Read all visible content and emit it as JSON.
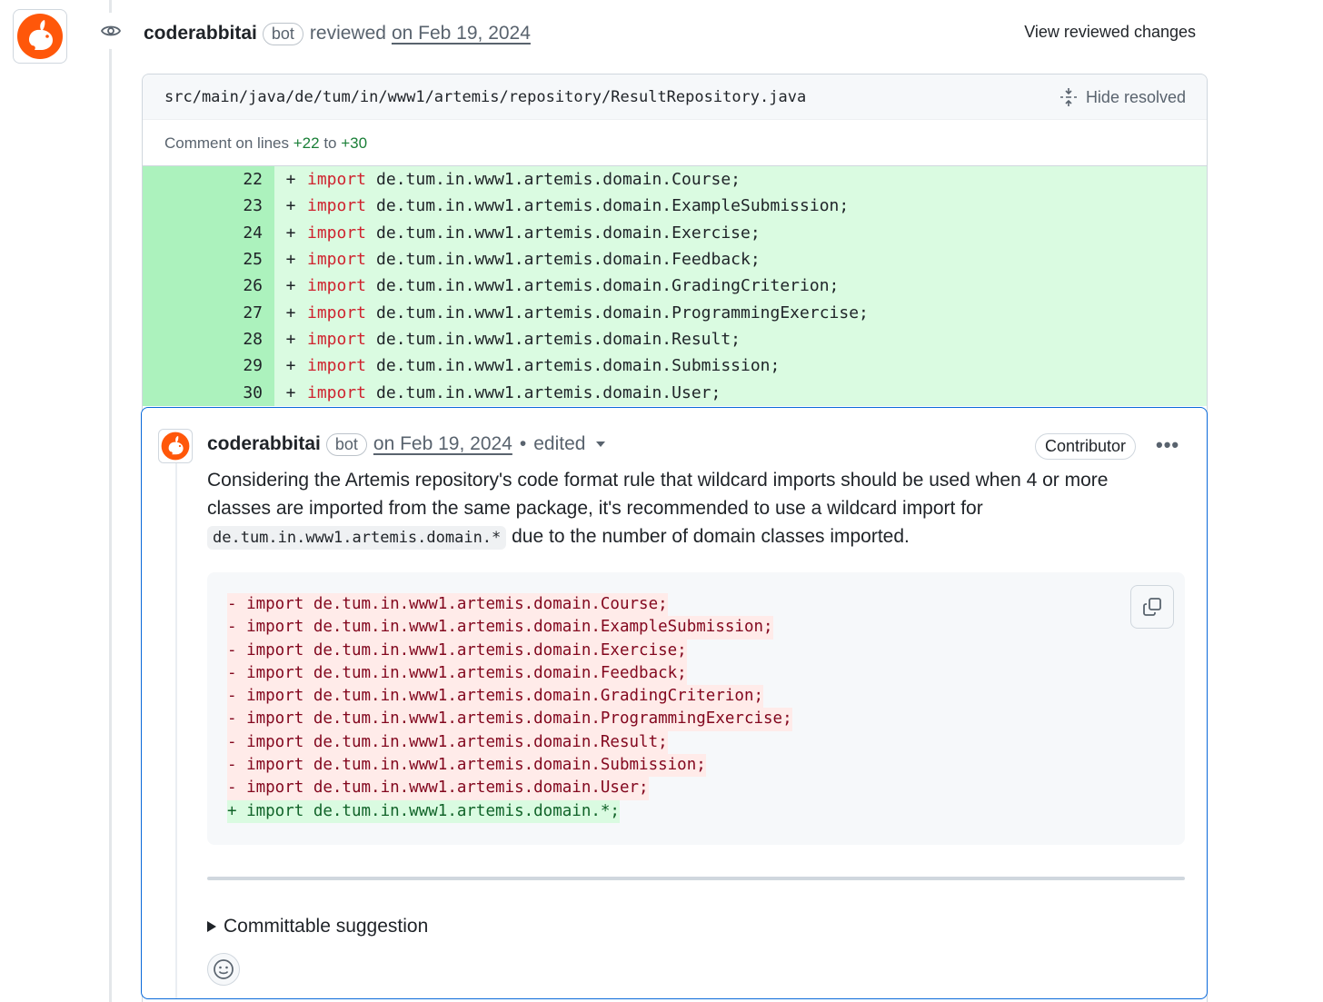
{
  "review": {
    "author": "coderabbitai",
    "bot_badge": "bot",
    "action": "reviewed",
    "date": "on Feb 19, 2024",
    "view_changes": "View reviewed changes"
  },
  "file": {
    "path": "src/main/java/de/tum/in/www1/artemis/repository/ResultRepository.java",
    "hide_resolved": "Hide resolved",
    "comment_on_prefix": "Comment on lines",
    "range_start": "+22",
    "range_to": "to",
    "range_end": "+30"
  },
  "diff_lines": [
    {
      "num": "22",
      "sign": "+",
      "keyword": "import",
      "code": "de.tum.in.www1.artemis.domain.Course;"
    },
    {
      "num": "23",
      "sign": "+",
      "keyword": "import",
      "code": "de.tum.in.www1.artemis.domain.ExampleSubmission;"
    },
    {
      "num": "24",
      "sign": "+",
      "keyword": "import",
      "code": "de.tum.in.www1.artemis.domain.Exercise;"
    },
    {
      "num": "25",
      "sign": "+",
      "keyword": "import",
      "code": "de.tum.in.www1.artemis.domain.Feedback;"
    },
    {
      "num": "26",
      "sign": "+",
      "keyword": "import",
      "code": "de.tum.in.www1.artemis.domain.GradingCriterion;"
    },
    {
      "num": "27",
      "sign": "+",
      "keyword": "import",
      "code": "de.tum.in.www1.artemis.domain.ProgrammingExercise;"
    },
    {
      "num": "28",
      "sign": "+",
      "keyword": "import",
      "code": "de.tum.in.www1.artemis.domain.Result;"
    },
    {
      "num": "29",
      "sign": "+",
      "keyword": "import",
      "code": "de.tum.in.www1.artemis.domain.Submission;"
    },
    {
      "num": "30",
      "sign": "+",
      "keyword": "import",
      "code": "de.tum.in.www1.artemis.domain.User;"
    }
  ],
  "comment": {
    "author": "coderabbitai",
    "bot_badge": "bot",
    "date": "on Feb 19, 2024",
    "separator": "•",
    "edited": "edited",
    "role_badge": "Contributor",
    "menu": "•••",
    "body_text_1": "Considering the Artemis repository's code format rule that wildcard imports should be used when 4 or more classes are imported from the same package, it's recommended to use a wildcard import for",
    "body_code": "de.tum.in.www1.artemis.domain.*",
    "body_text_2": "due to the number of domain classes imported.",
    "suggestion_label": "Committable suggestion"
  },
  "suggestion_lines": [
    {
      "type": "del",
      "text": "- import de.tum.in.www1.artemis.domain.Course;"
    },
    {
      "type": "del",
      "text": "- import de.tum.in.www1.artemis.domain.ExampleSubmission;"
    },
    {
      "type": "del",
      "text": "- import de.tum.in.www1.artemis.domain.Exercise;"
    },
    {
      "type": "del",
      "text": "- import de.tum.in.www1.artemis.domain.Feedback;"
    },
    {
      "type": "del",
      "text": "- import de.tum.in.www1.artemis.domain.GradingCriterion;"
    },
    {
      "type": "del",
      "text": "- import de.tum.in.www1.artemis.domain.ProgrammingExercise;"
    },
    {
      "type": "del",
      "text": "- import de.tum.in.www1.artemis.domain.Result;"
    },
    {
      "type": "del",
      "text": "- import de.tum.in.www1.artemis.domain.Submission;"
    },
    {
      "type": "del",
      "text": "- import de.tum.in.www1.artemis.domain.User;"
    },
    {
      "type": "add",
      "text": "+ import de.tum.in.www1.artemis.domain.*;"
    }
  ],
  "icons": {
    "avatar": "coderabbit-avatar-icon",
    "eye": "eye-icon",
    "hide_resolved": "fold-icon",
    "copy": "copy-icon",
    "expand": "triangle-right-icon",
    "emoji": "smiley-icon"
  },
  "colors": {
    "brand_orange": "#ff570a",
    "diff_add_bg": "#dafbe1",
    "diff_add_num_bg": "#acf2bd",
    "diff_del_bg": "#ffebe9",
    "focus_border": "#0969da"
  }
}
